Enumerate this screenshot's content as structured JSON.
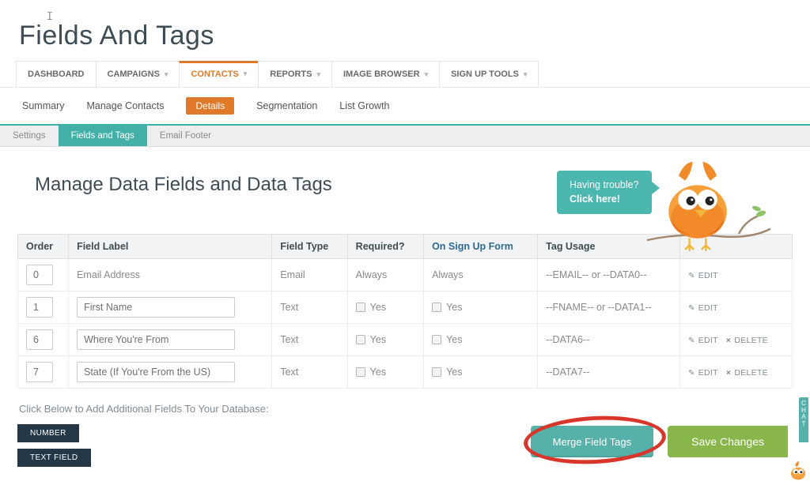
{
  "page_title": "Fields And Tags",
  "primary_nav": {
    "items": [
      {
        "label": "DASHBOARD",
        "has_dropdown": false
      },
      {
        "label": "CAMPAIGNS",
        "has_dropdown": true
      },
      {
        "label": "CONTACTS",
        "has_dropdown": true,
        "active": true
      },
      {
        "label": "REPORTS",
        "has_dropdown": true
      },
      {
        "label": "IMAGE BROWSER",
        "has_dropdown": true
      },
      {
        "label": "SIGN UP TOOLS",
        "has_dropdown": true
      }
    ]
  },
  "secondary_nav": {
    "items": [
      {
        "label": "Summary"
      },
      {
        "label": "Manage Contacts"
      },
      {
        "label": "Details",
        "active": true
      },
      {
        "label": "Segmentation"
      },
      {
        "label": "List Growth"
      }
    ]
  },
  "tertiary_nav": {
    "items": [
      {
        "label": "Settings"
      },
      {
        "label": "Fields and Tags",
        "active": true
      },
      {
        "label": "Email Footer"
      }
    ]
  },
  "section_title": "Manage Data Fields and Data Tags",
  "help_bubble": {
    "line1": "Having trouble?",
    "line2": "Click here!"
  },
  "table": {
    "columns": {
      "order": "Order",
      "label": "Field Label",
      "type": "Field Type",
      "required": "Required?",
      "signup": "On Sign Up Form",
      "tag": "Tag Usage"
    },
    "rows": [
      {
        "order": "0",
        "label": "Email Address",
        "label_editable": false,
        "type": "Email",
        "required": "Always",
        "required_checkbox": false,
        "signup": "Always",
        "signup_checkbox": false,
        "tag": "--EMAIL-- or --DATA0--",
        "edit": "EDIT",
        "can_delete": false,
        "delete": ""
      },
      {
        "order": "1",
        "label": "First Name",
        "label_editable": true,
        "type": "Text",
        "required": "Yes",
        "required_checkbox": true,
        "signup": "Yes",
        "signup_checkbox": true,
        "tag": "--FNAME-- or --DATA1--",
        "edit": "EDIT",
        "can_delete": false,
        "delete": ""
      },
      {
        "order": "6",
        "label": "Where You're From",
        "label_editable": true,
        "type": "Text",
        "required": "Yes",
        "required_checkbox": true,
        "signup": "Yes",
        "signup_checkbox": true,
        "tag": "--DATA6--",
        "edit": "EDIT",
        "can_delete": true,
        "delete": "DELETE"
      },
      {
        "order": "7",
        "label": "State (If You're From the US)",
        "label_editable": true,
        "type": "Text",
        "required": "Yes",
        "required_checkbox": true,
        "signup": "Yes",
        "signup_checkbox": true,
        "tag": "--DATA7--",
        "edit": "EDIT",
        "can_delete": true,
        "delete": "DELETE"
      }
    ]
  },
  "below_note": "Click Below to Add Additional Fields To Your Database:",
  "add_buttons": {
    "number": "NUMBER",
    "text": "TEXT FIELD"
  },
  "actions": {
    "merge": "Merge Field Tags",
    "save": "Save Changes"
  },
  "corner_label": "CHAT"
}
